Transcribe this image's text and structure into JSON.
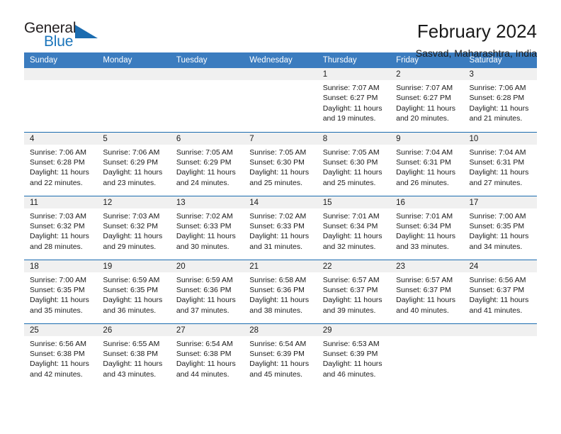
{
  "brand": {
    "name_part1": "General",
    "name_part2": "Blue",
    "triangle_icon": "triangle-icon",
    "accent_color": "#1b75bb"
  },
  "header": {
    "title": "February 2024",
    "location": "Sasvad, Maharashtra, India"
  },
  "colors": {
    "header_blue": "#3b7cbf",
    "row_divider_blue": "#1b6cb0",
    "daynum_band": "#f0f0f0",
    "text": "#1a1a1a"
  },
  "calendar": {
    "weekday_headers": [
      "Sunday",
      "Monday",
      "Tuesday",
      "Wednesday",
      "Thursday",
      "Friday",
      "Saturday"
    ],
    "weeks": [
      [
        {
          "day": "",
          "empty": true,
          "sunrise": "",
          "sunset": "",
          "daylight_line1": "",
          "daylight_line2": ""
        },
        {
          "day": "",
          "empty": true,
          "sunrise": "",
          "sunset": "",
          "daylight_line1": "",
          "daylight_line2": ""
        },
        {
          "day": "",
          "empty": true,
          "sunrise": "",
          "sunset": "",
          "daylight_line1": "",
          "daylight_line2": ""
        },
        {
          "day": "",
          "empty": true,
          "sunrise": "",
          "sunset": "",
          "daylight_line1": "",
          "daylight_line2": ""
        },
        {
          "day": "1",
          "empty": false,
          "sunrise": "Sunrise: 7:07 AM",
          "sunset": "Sunset: 6:27 PM",
          "daylight_line1": "Daylight: 11 hours",
          "daylight_line2": "and 19 minutes."
        },
        {
          "day": "2",
          "empty": false,
          "sunrise": "Sunrise: 7:07 AM",
          "sunset": "Sunset: 6:27 PM",
          "daylight_line1": "Daylight: 11 hours",
          "daylight_line2": "and 20 minutes."
        },
        {
          "day": "3",
          "empty": false,
          "sunrise": "Sunrise: 7:06 AM",
          "sunset": "Sunset: 6:28 PM",
          "daylight_line1": "Daylight: 11 hours",
          "daylight_line2": "and 21 minutes."
        }
      ],
      [
        {
          "day": "4",
          "empty": false,
          "sunrise": "Sunrise: 7:06 AM",
          "sunset": "Sunset: 6:28 PM",
          "daylight_line1": "Daylight: 11 hours",
          "daylight_line2": "and 22 minutes."
        },
        {
          "day": "5",
          "empty": false,
          "sunrise": "Sunrise: 7:06 AM",
          "sunset": "Sunset: 6:29 PM",
          "daylight_line1": "Daylight: 11 hours",
          "daylight_line2": "and 23 minutes."
        },
        {
          "day": "6",
          "empty": false,
          "sunrise": "Sunrise: 7:05 AM",
          "sunset": "Sunset: 6:29 PM",
          "daylight_line1": "Daylight: 11 hours",
          "daylight_line2": "and 24 minutes."
        },
        {
          "day": "7",
          "empty": false,
          "sunrise": "Sunrise: 7:05 AM",
          "sunset": "Sunset: 6:30 PM",
          "daylight_line1": "Daylight: 11 hours",
          "daylight_line2": "and 25 minutes."
        },
        {
          "day": "8",
          "empty": false,
          "sunrise": "Sunrise: 7:05 AM",
          "sunset": "Sunset: 6:30 PM",
          "daylight_line1": "Daylight: 11 hours",
          "daylight_line2": "and 25 minutes."
        },
        {
          "day": "9",
          "empty": false,
          "sunrise": "Sunrise: 7:04 AM",
          "sunset": "Sunset: 6:31 PM",
          "daylight_line1": "Daylight: 11 hours",
          "daylight_line2": "and 26 minutes."
        },
        {
          "day": "10",
          "empty": false,
          "sunrise": "Sunrise: 7:04 AM",
          "sunset": "Sunset: 6:31 PM",
          "daylight_line1": "Daylight: 11 hours",
          "daylight_line2": "and 27 minutes."
        }
      ],
      [
        {
          "day": "11",
          "empty": false,
          "sunrise": "Sunrise: 7:03 AM",
          "sunset": "Sunset: 6:32 PM",
          "daylight_line1": "Daylight: 11 hours",
          "daylight_line2": "and 28 minutes."
        },
        {
          "day": "12",
          "empty": false,
          "sunrise": "Sunrise: 7:03 AM",
          "sunset": "Sunset: 6:32 PM",
          "daylight_line1": "Daylight: 11 hours",
          "daylight_line2": "and 29 minutes."
        },
        {
          "day": "13",
          "empty": false,
          "sunrise": "Sunrise: 7:02 AM",
          "sunset": "Sunset: 6:33 PM",
          "daylight_line1": "Daylight: 11 hours",
          "daylight_line2": "and 30 minutes."
        },
        {
          "day": "14",
          "empty": false,
          "sunrise": "Sunrise: 7:02 AM",
          "sunset": "Sunset: 6:33 PM",
          "daylight_line1": "Daylight: 11 hours",
          "daylight_line2": "and 31 minutes."
        },
        {
          "day": "15",
          "empty": false,
          "sunrise": "Sunrise: 7:01 AM",
          "sunset": "Sunset: 6:34 PM",
          "daylight_line1": "Daylight: 11 hours",
          "daylight_line2": "and 32 minutes."
        },
        {
          "day": "16",
          "empty": false,
          "sunrise": "Sunrise: 7:01 AM",
          "sunset": "Sunset: 6:34 PM",
          "daylight_line1": "Daylight: 11 hours",
          "daylight_line2": "and 33 minutes."
        },
        {
          "day": "17",
          "empty": false,
          "sunrise": "Sunrise: 7:00 AM",
          "sunset": "Sunset: 6:35 PM",
          "daylight_line1": "Daylight: 11 hours",
          "daylight_line2": "and 34 minutes."
        }
      ],
      [
        {
          "day": "18",
          "empty": false,
          "sunrise": "Sunrise: 7:00 AM",
          "sunset": "Sunset: 6:35 PM",
          "daylight_line1": "Daylight: 11 hours",
          "daylight_line2": "and 35 minutes."
        },
        {
          "day": "19",
          "empty": false,
          "sunrise": "Sunrise: 6:59 AM",
          "sunset": "Sunset: 6:35 PM",
          "daylight_line1": "Daylight: 11 hours",
          "daylight_line2": "and 36 minutes."
        },
        {
          "day": "20",
          "empty": false,
          "sunrise": "Sunrise: 6:59 AM",
          "sunset": "Sunset: 6:36 PM",
          "daylight_line1": "Daylight: 11 hours",
          "daylight_line2": "and 37 minutes."
        },
        {
          "day": "21",
          "empty": false,
          "sunrise": "Sunrise: 6:58 AM",
          "sunset": "Sunset: 6:36 PM",
          "daylight_line1": "Daylight: 11 hours",
          "daylight_line2": "and 38 minutes."
        },
        {
          "day": "22",
          "empty": false,
          "sunrise": "Sunrise: 6:57 AM",
          "sunset": "Sunset: 6:37 PM",
          "daylight_line1": "Daylight: 11 hours",
          "daylight_line2": "and 39 minutes."
        },
        {
          "day": "23",
          "empty": false,
          "sunrise": "Sunrise: 6:57 AM",
          "sunset": "Sunset: 6:37 PM",
          "daylight_line1": "Daylight: 11 hours",
          "daylight_line2": "and 40 minutes."
        },
        {
          "day": "24",
          "empty": false,
          "sunrise": "Sunrise: 6:56 AM",
          "sunset": "Sunset: 6:37 PM",
          "daylight_line1": "Daylight: 11 hours",
          "daylight_line2": "and 41 minutes."
        }
      ],
      [
        {
          "day": "25",
          "empty": false,
          "sunrise": "Sunrise: 6:56 AM",
          "sunset": "Sunset: 6:38 PM",
          "daylight_line1": "Daylight: 11 hours",
          "daylight_line2": "and 42 minutes."
        },
        {
          "day": "26",
          "empty": false,
          "sunrise": "Sunrise: 6:55 AM",
          "sunset": "Sunset: 6:38 PM",
          "daylight_line1": "Daylight: 11 hours",
          "daylight_line2": "and 43 minutes."
        },
        {
          "day": "27",
          "empty": false,
          "sunrise": "Sunrise: 6:54 AM",
          "sunset": "Sunset: 6:38 PM",
          "daylight_line1": "Daylight: 11 hours",
          "daylight_line2": "and 44 minutes."
        },
        {
          "day": "28",
          "empty": false,
          "sunrise": "Sunrise: 6:54 AM",
          "sunset": "Sunset: 6:39 PM",
          "daylight_line1": "Daylight: 11 hours",
          "daylight_line2": "and 45 minutes."
        },
        {
          "day": "29",
          "empty": false,
          "sunrise": "Sunrise: 6:53 AM",
          "sunset": "Sunset: 6:39 PM",
          "daylight_line1": "Daylight: 11 hours",
          "daylight_line2": "and 46 minutes."
        },
        {
          "day": "",
          "empty": true,
          "sunrise": "",
          "sunset": "",
          "daylight_line1": "",
          "daylight_line2": ""
        },
        {
          "day": "",
          "empty": true,
          "sunrise": "",
          "sunset": "",
          "daylight_line1": "",
          "daylight_line2": ""
        }
      ]
    ]
  }
}
